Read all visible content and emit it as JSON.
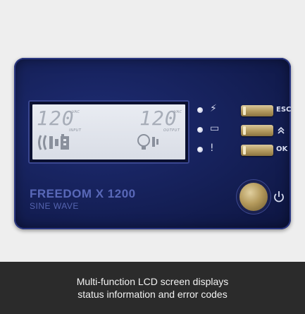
{
  "lcd": {
    "input_value": "120",
    "output_value": "120",
    "input_unit": "VAC",
    "output_unit": "VAC",
    "input_label": "INPUT",
    "output_label": "OUTPUT"
  },
  "controls": {
    "esc_label": "ESC",
    "ok_label": "OK",
    "up_label": "^"
  },
  "product": {
    "name": "FREEDOM X 1200",
    "subtitle": "SINE WAVE"
  },
  "caption": {
    "line1": "Multi-function LCD screen displays",
    "line2": "status information and error codes"
  },
  "colors": {
    "panel": "#152058",
    "lcd": "#e2e5ec",
    "button_gold": "#b69d62",
    "caption_bg": "#2b2b2b"
  }
}
